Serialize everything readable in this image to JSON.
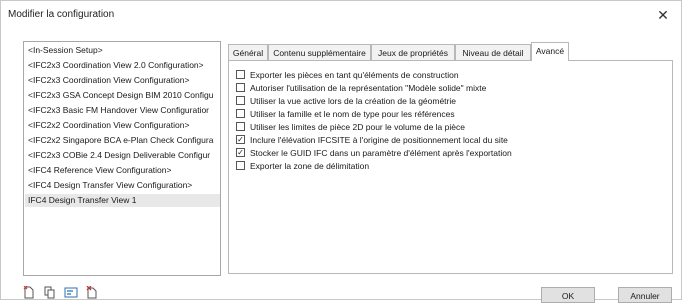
{
  "dialog": {
    "title": "Modifier la configuration"
  },
  "configs": {
    "items": [
      "<In-Session Setup>",
      "<IFC2x3 Coordination View 2.0 Configuration>",
      "<IFC2x3 Coordination View Configuration>",
      "<IFC2x3 GSA Concept Design BIM 2010 Configu",
      "<IFC2x3 Basic FM Handover View Configuratior",
      "<IFC2x2 Coordination View Configuration>",
      "<IFC2x2 Singapore BCA e-Plan Check Configura",
      "<IFC2x3 COBie 2.4 Design Deliverable Configur",
      "<IFC4 Reference View Configuration>",
      "<IFC4 Design Transfer View Configuration>",
      "IFC4 Design Transfer View 1"
    ],
    "selected_index": 10
  },
  "tabs": [
    "Général",
    "Contenu supplémentaire",
    "Jeux de propriétés",
    "Niveau de détail",
    "Avancé"
  ],
  "active_tab": "Avancé",
  "options": [
    {
      "label": "Exporter les pièces en tant qu'éléments de construction",
      "checked": false
    },
    {
      "label": "Autoriser l'utilisation de la représentation \"Modèle solide\" mixte",
      "checked": false
    },
    {
      "label": "Utiliser la vue active lors de la création de la géométrie",
      "checked": false
    },
    {
      "label": "Utiliser la famille et le nom de type pour les références",
      "checked": false
    },
    {
      "label": "Utiliser les limites de pièce 2D pour le volume de la pièce",
      "checked": false
    },
    {
      "label": "Inclure l'élévation IFCSITE à l'origine de positionnement local du site",
      "checked": true
    },
    {
      "label": "Stocker le GUID IFC dans un paramètre d'élément après l'exportation",
      "checked": true
    },
    {
      "label": "Exporter la zone de délimitation",
      "checked": false
    }
  ],
  "buttons": {
    "ok": "OK",
    "cancel": "Annuler"
  },
  "icons": {
    "close": "close-icon",
    "bottom": [
      "new-setup-icon",
      "duplicate-setup-icon",
      "rename-setup-icon",
      "delete-setup-icon"
    ]
  },
  "colors": {
    "selection": "#e8e8e8",
    "border": "#b8b8b8",
    "button": "#e1e1e1",
    "icon_red": "#c0392b",
    "icon_blue": "#2f6fb5"
  }
}
